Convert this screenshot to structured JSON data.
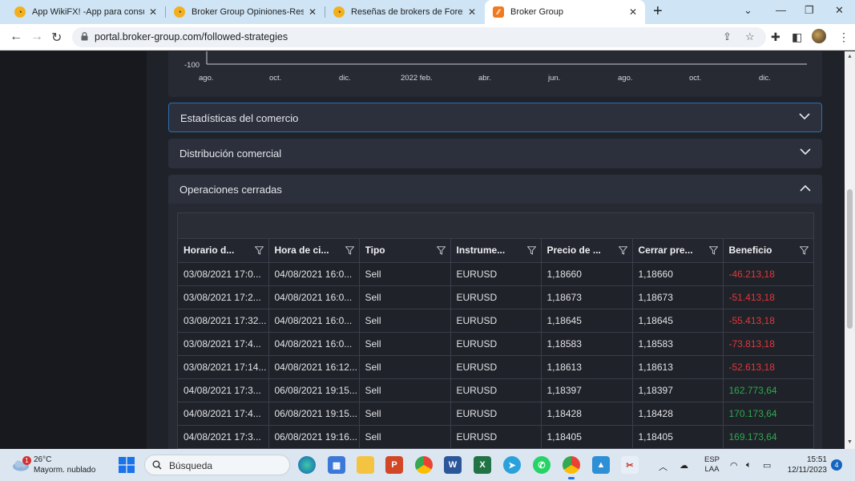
{
  "browser": {
    "tabs": [
      {
        "title": "App WikiFX! -App para consulta"
      },
      {
        "title": "Broker Group Opiniones-Reseña"
      },
      {
        "title": "Reseñas de brokers de Forex-Pla"
      },
      {
        "title": "Broker Group"
      }
    ],
    "url": "portal.broker-group.com/followed-strategies"
  },
  "chart": {
    "y_tick": "-100",
    "x_ticks": [
      "ago.",
      "oct.",
      "dic.",
      "2022 feb.",
      "abr.",
      "jun.",
      "ago.",
      "oct.",
      "dic."
    ]
  },
  "sections": {
    "trade_stats": "Estadísticas del comercio",
    "trade_distribution": "Distribución comercial",
    "closed_operations": "Operaciones cerradas"
  },
  "table": {
    "columns": [
      "Horario d...",
      "Hora de ci...",
      "Tipo",
      "Instrume...",
      "Precio de ...",
      "Cerrar pre...",
      "Beneficio"
    ],
    "rows": [
      {
        "open": "03/08/2021 17:0...",
        "close": "04/08/2021 16:0...",
        "type": "Sell",
        "instrument": "EURUSD",
        "open_price": "1,18660",
        "close_price": "1,18660",
        "profit": "-46.213,18"
      },
      {
        "open": "03/08/2021 17:2...",
        "close": "04/08/2021 16:0...",
        "type": "Sell",
        "instrument": "EURUSD",
        "open_price": "1,18673",
        "close_price": "1,18673",
        "profit": "-51.413,18"
      },
      {
        "open": "03/08/2021 17:32...",
        "close": "04/08/2021 16:0...",
        "type": "Sell",
        "instrument": "EURUSD",
        "open_price": "1,18645",
        "close_price": "1,18645",
        "profit": "-55.413,18"
      },
      {
        "open": "03/08/2021 17:4...",
        "close": "04/08/2021 16:0...",
        "type": "Sell",
        "instrument": "EURUSD",
        "open_price": "1,18583",
        "close_price": "1,18583",
        "profit": "-73.813,18"
      },
      {
        "open": "03/08/2021 17:14...",
        "close": "04/08/2021 16:12...",
        "type": "Sell",
        "instrument": "EURUSD",
        "open_price": "1,18613",
        "close_price": "1,18613",
        "profit": "-52.613,18"
      },
      {
        "open": "04/08/2021 17:3...",
        "close": "06/08/2021 19:15...",
        "type": "Sell",
        "instrument": "EURUSD",
        "open_price": "1,18397",
        "close_price": "1,18397",
        "profit": "162.773,64"
      },
      {
        "open": "04/08/2021 17:4...",
        "close": "06/08/2021 19:15...",
        "type": "Sell",
        "instrument": "EURUSD",
        "open_price": "1,18428",
        "close_price": "1,18428",
        "profit": "170.173,64"
      },
      {
        "open": "04/08/2021 17:3...",
        "close": "06/08/2021 19:16...",
        "type": "Sell",
        "instrument": "EURUSD",
        "open_price": "1,18405",
        "close_price": "1,18405",
        "profit": "169.173,64"
      }
    ]
  },
  "colors": {
    "negative": "#e2383b",
    "positive": "#2fa84f",
    "accent": "#2a6fb0"
  },
  "taskbar": {
    "temperature": "26°C",
    "weather": "Mayorm. nublado",
    "weather_badge": "1",
    "search_placeholder": "Búsqueda",
    "lang_top": "ESP",
    "lang_bottom": "LAA",
    "time": "15:51",
    "date": "12/11/2023",
    "notifications": "4",
    "apps": [
      "edge",
      "store",
      "files",
      "powerpoint",
      "chrome",
      "word",
      "excel",
      "telegram",
      "whatsapp",
      "chrome-active",
      "photos",
      "screen-tool"
    ]
  }
}
